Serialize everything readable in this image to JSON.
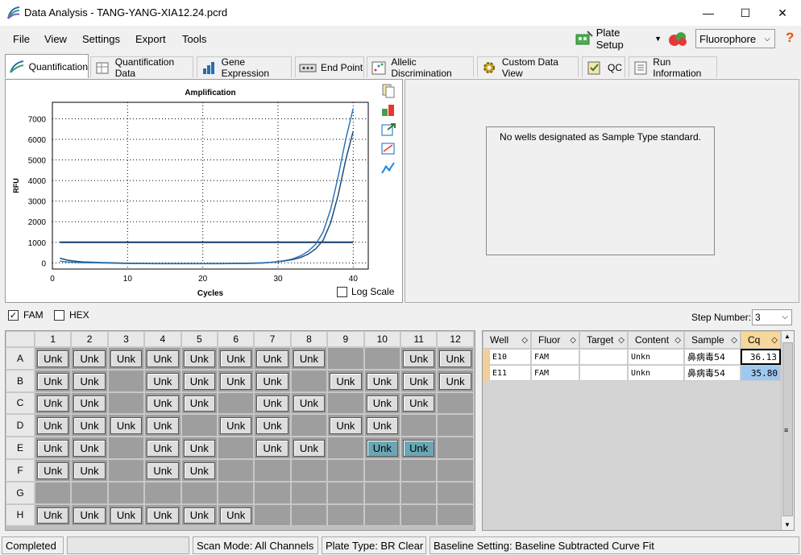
{
  "window": {
    "title": "Data Analysis - TANG-YANG-XIA12.24.pcrd",
    "minimize": "—",
    "maximize": "☐",
    "close": "✕"
  },
  "menu": {
    "file": "File",
    "view": "View",
    "settings": "Settings",
    "export": "Export",
    "tools": "Tools"
  },
  "toolbar": {
    "plate_setup": "Plate Setup",
    "fluorophore": "Fluorophore",
    "help": "?"
  },
  "tabs": [
    {
      "label": "Quantification"
    },
    {
      "label": "Quantification Data"
    },
    {
      "label": "Gene Expression"
    },
    {
      "label": "End Point"
    },
    {
      "label": "Allelic Discrimination"
    },
    {
      "label": "Custom Data View"
    },
    {
      "label": "QC"
    },
    {
      "label": "Run Information"
    }
  ],
  "chart_data": {
    "type": "line",
    "title": "Amplification",
    "xlabel": "Cycles",
    "ylabel": "RFU",
    "xlim": [
      0,
      42
    ],
    "ylim": [
      -300,
      7800
    ],
    "xticks": [
      0,
      10,
      20,
      30,
      40
    ],
    "yticks": [
      0,
      1000,
      2000,
      3000,
      4000,
      5000,
      6000,
      7000
    ],
    "threshold": 1000,
    "grid": true,
    "log_scale": false,
    "series": [
      {
        "well": "E10",
        "color": "#1f4e79",
        "x": [
          1,
          2,
          3,
          4,
          6,
          8,
          10,
          14,
          18,
          22,
          26,
          28,
          30,
          31,
          32,
          33,
          34,
          35,
          36,
          37,
          38,
          39,
          40
        ],
        "y": [
          230,
          130,
          80,
          50,
          20,
          0,
          -20,
          -30,
          -30,
          -30,
          -20,
          0,
          50,
          100,
          160,
          260,
          420,
          680,
          1100,
          1950,
          3300,
          5000,
          6400
        ]
      },
      {
        "well": "E11",
        "color": "#2e75b6",
        "x": [
          1,
          2,
          3,
          4,
          6,
          8,
          10,
          14,
          18,
          22,
          26,
          28,
          30,
          31,
          32,
          33,
          34,
          35,
          36,
          37,
          38,
          39,
          40
        ],
        "y": [
          80,
          40,
          20,
          10,
          0,
          -20,
          -30,
          -40,
          -40,
          -40,
          -30,
          -10,
          60,
          120,
          200,
          340,
          560,
          900,
          1500,
          2600,
          4200,
          6000,
          7500
        ]
      }
    ]
  },
  "amp_controls": {
    "log_scale": "Log Scale"
  },
  "std_curve": {
    "message": "No wells designated as Sample Type standard."
  },
  "fluor_filters": {
    "fam": "FAM",
    "hex": "HEX"
  },
  "step": {
    "label": "Step Number:",
    "value": "3"
  },
  "plate": {
    "cols": [
      "1",
      "2",
      "3",
      "4",
      "5",
      "6",
      "7",
      "8",
      "9",
      "10",
      "11",
      "12"
    ],
    "rows": [
      "A",
      "B",
      "C",
      "D",
      "E",
      "F",
      "G",
      "H"
    ],
    "well_label": "Unk",
    "wells": [
      [
        1,
        1,
        1,
        1,
        1,
        1,
        1,
        1,
        0,
        0,
        1,
        1
      ],
      [
        1,
        1,
        0,
        1,
        1,
        1,
        1,
        0,
        1,
        1,
        1,
        1
      ],
      [
        1,
        1,
        0,
        1,
        1,
        0,
        1,
        1,
        0,
        1,
        1,
        0
      ],
      [
        1,
        1,
        1,
        1,
        0,
        1,
        1,
        0,
        1,
        1,
        0,
        0
      ],
      [
        1,
        1,
        0,
        1,
        1,
        0,
        1,
        1,
        0,
        2,
        2,
        0
      ],
      [
        1,
        1,
        0,
        1,
        1,
        0,
        0,
        0,
        0,
        0,
        0,
        0
      ],
      [
        0,
        0,
        0,
        0,
        0,
        0,
        0,
        0,
        0,
        0,
        0,
        0
      ],
      [
        1,
        1,
        1,
        1,
        1,
        1,
        0,
        0,
        0,
        0,
        0,
        0
      ]
    ]
  },
  "results": {
    "columns": [
      "Well",
      "Fluor",
      "Target",
      "Content",
      "Sample",
      "Cq"
    ],
    "rows": [
      [
        "E10",
        "FAM",
        "",
        "Unkn",
        "鼻病毒54",
        "36.13"
      ],
      [
        "E11",
        "FAM",
        "",
        "Unkn",
        "鼻病毒54",
        "35.80"
      ]
    ]
  },
  "status": {
    "state": "Completed",
    "scan_mode": "Scan Mode: All Channels",
    "plate_type": "Plate Type: BR Clear",
    "baseline": "Baseline Setting: Baseline Subtracted Curve Fit"
  },
  "colors": {
    "selected_well": "#6aa7b5",
    "cq_highlight": "#9fc8f0"
  }
}
